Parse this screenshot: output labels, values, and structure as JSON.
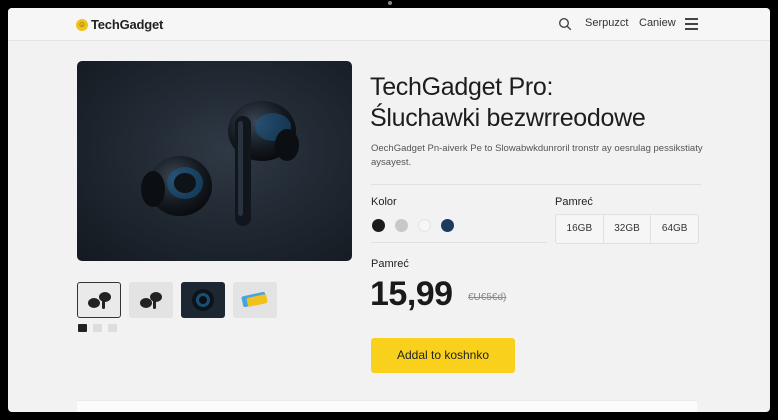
{
  "header": {
    "logo_text": "TechGadget",
    "nav": [
      "Serpuzct",
      "Caniew"
    ]
  },
  "product": {
    "title_line1": "TechGadget Pro:",
    "title_line2": "Śluchawki bezwrreodowe",
    "description": "OechGadget Pn-aiverk Pe to Slowabwkdunroril tronstr ay oesrulag pessikstiaty aysayest.",
    "color_label": "Kolor",
    "colors": [
      "#1b1b1b",
      "#c8c8c8",
      "#f4f4f4",
      "#1f3a5f"
    ],
    "memory_label": "Pamreć",
    "memory_options": [
      "16GB",
      "32GB",
      "64GB"
    ],
    "price_label": "Pamreć",
    "price": "15,99",
    "old_price": "€U€5€d)",
    "cta_label": "Addal to koshnko"
  }
}
